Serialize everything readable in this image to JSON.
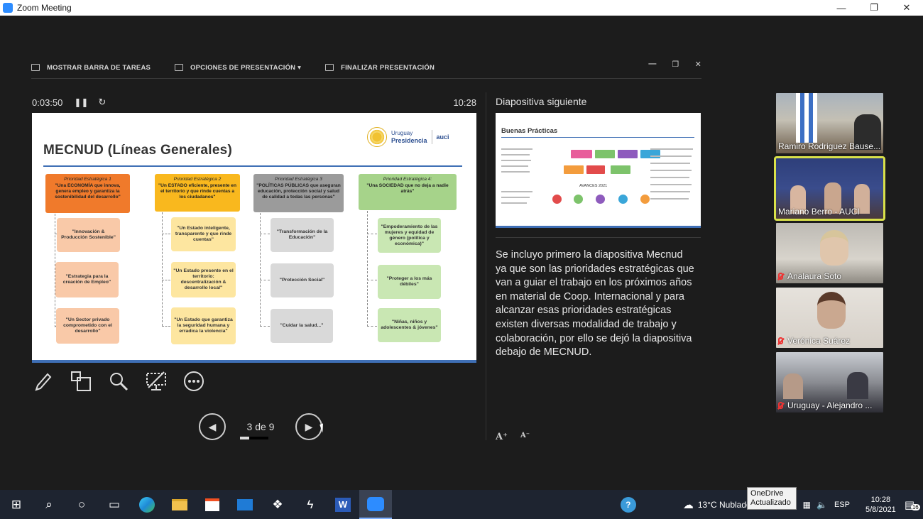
{
  "window": {
    "title": "Zoom Meeting",
    "controls": [
      "—",
      "❐",
      "✕"
    ]
  },
  "presenter_toolbar": {
    "show_taskbar": "MOSTRAR BARRA DE TAREAS",
    "presentation_options": "OPCIONES DE PRESENTACIÓN ▾",
    "end_presentation": "FINALIZAR PRESENTACIÓN"
  },
  "timer": {
    "elapsed": "0:03:50",
    "pause": "❚❚",
    "reset": "↻",
    "clock": "10:28"
  },
  "slide": {
    "title": "MECNUD (Líneas Generales)",
    "logo": {
      "line1": "Uruguay",
      "line2": "Presidencia",
      "auci": "auci"
    },
    "priorities": [
      {
        "label": "Prioridad Estratégica 1",
        "text": "\"Una ECONOMÍA que innova, genera empleo y garantiza la sostenibilidad del desarrollo\"",
        "subs": [
          "\"Innovación & Producción Sostenible\"",
          "\"Estrategia para la creación de Empleo\"",
          "\"Un Sector privado comprometido con el desarrollo\""
        ]
      },
      {
        "label": "Prioridad Estratégica 2",
        "text": "\"Un ESTADO eficiente, presente en el territorio y que rinde cuentas a los ciudadanos\"",
        "subs": [
          "\"Un Estado inteligente, transparente y que rinde cuentas\"",
          "\"Un Estado presente en el territorio: descentralización & desarrollo local\"",
          "\"Un Estado que garantiza la seguridad humana y erradica la violencia\""
        ]
      },
      {
        "label": "Prioridad Estratégica 3",
        "text": "\"POLÍTICAS PÚBLICAS que aseguran educación, protección social y salud de calidad a todas las personas\"",
        "subs": [
          "\"Transformación de la Educación\"",
          "\"Protección Social\"",
          "\"Cuidar la salud...\""
        ]
      },
      {
        "label": "Prioridad Estratégica 4:",
        "text": "\"Una SOCIEDAD que no deja a nadie atrás\"",
        "subs": [
          "\"Empoderamiento de las mujeres y equidad de género (política y económica)\"",
          "\"Proteger a los más débiles\"",
          "\"Niñas, niños y adolescentes & jóvenes\""
        ]
      }
    ],
    "colors": {
      "p1_head": "#f07a2b",
      "p1_sub": "#f9c9a8",
      "p2_head": "#f9b81e",
      "p2_sub": "#fde6a0",
      "p3_head": "#9b9b9b",
      "p3_sub": "#d9d9d9",
      "p4_head": "#a6d38a",
      "p4_sub": "#c9e7b3"
    }
  },
  "slide_tools": [
    "pen-icon",
    "layers-icon",
    "magnifier-icon",
    "screen-off-icon",
    "more-icon"
  ],
  "navigation": {
    "prev": "◀",
    "page": "3 de 9",
    "next": "▶",
    "progress": 0.33
  },
  "next_slide": {
    "label": "Diapositiva siguiente",
    "title": "Buenas Prácticas",
    "avances": "AVANCES 2021"
  },
  "notes": "Se incluyo primero la diapositiva Mecnud ya que son las prioridades estratégicas que van a guiar el trabajo en los próximos años en material de Coop. Internacional y para alcanzar esas prioridades estratégicas existen diversas modalidad de trabajo y colaboración, por ello se dejó la diapositiva debajo de MECNUD.",
  "font_buttons": {
    "increase": "A⁺",
    "decrease": "A⁻"
  },
  "participants": [
    {
      "name": "Ramiro Rodriguez Bause...",
      "muted": false,
      "active": false
    },
    {
      "name": "Mariano Berro - AUCI",
      "muted": false,
      "active": true
    },
    {
      "name": "Analaura Soto",
      "muted": true,
      "active": false
    },
    {
      "name": "Verónica Suárez",
      "muted": true,
      "active": false
    },
    {
      "name": "Uruguay - Alejandro ...",
      "muted": true,
      "active": false
    }
  ],
  "taskbar": {
    "weather": "13°C  Nublado",
    "lang": "ESP",
    "time": "10:28",
    "date": "5/8/2021",
    "notifications": "16",
    "tooltip": {
      "line1": "OneDrive",
      "line2": "Actualizado"
    }
  }
}
